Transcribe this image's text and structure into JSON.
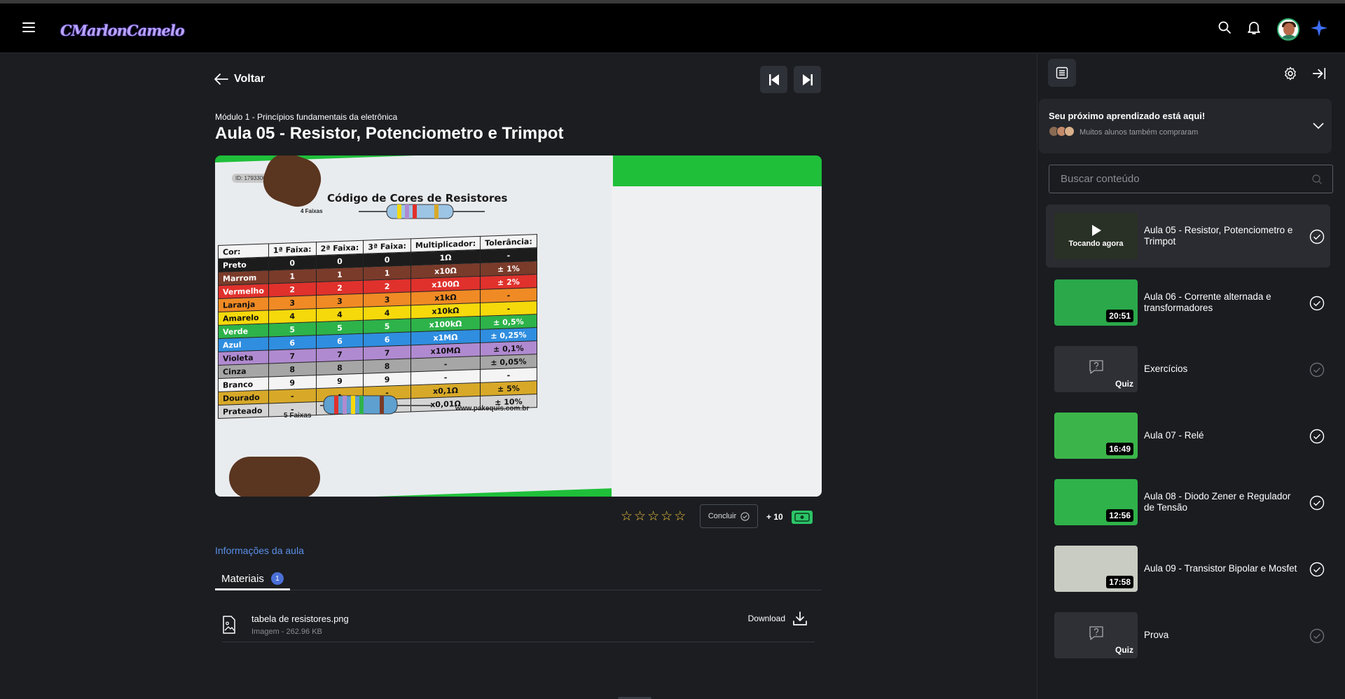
{
  "header": {
    "logo_text": "CMarlonCamelo",
    "icons": [
      "menu-icon",
      "search-icon",
      "bell-icon",
      "avatar",
      "sparkle-icon"
    ]
  },
  "lesson": {
    "back_label": "Voltar",
    "module": "Módulo 1 - Princípios fundamentais da eletrônica",
    "title": "Aula 05 - Resistor, Potenciometro e Trimpot",
    "video": {
      "id_label": "ID: 17933068",
      "chart_title": "Código de Cores de Resistores",
      "band4_label": "4 Faixas",
      "band5_label": "5 Faixas",
      "site": "www.pakequis.com.br",
      "table_headers": [
        "Cor:",
        "1ª Faixa:",
        "2ª Faixa:",
        "3ª Faixa:",
        "Multiplicador:",
        "Tolerância:"
      ],
      "table_rows": [
        {
          "cells": [
            "Preto",
            "0",
            "0",
            "0",
            "1Ω",
            "-"
          ],
          "color": "#1c1c1c",
          "text": "#ffffff"
        },
        {
          "cells": [
            "Marrom",
            "1",
            "1",
            "1",
            "x10Ω",
            "± 1%"
          ],
          "color": "#7a3b2a",
          "text": "#ffffff"
        },
        {
          "cells": [
            "Vermelho",
            "2",
            "2",
            "2",
            "x100Ω",
            "± 2%"
          ],
          "color": "#e0312c",
          "text": "#ffffff"
        },
        {
          "cells": [
            "Laranja",
            "3",
            "3",
            "3",
            "x1kΩ",
            "-"
          ],
          "color": "#f08a24",
          "text": "#111111"
        },
        {
          "cells": [
            "Amarelo",
            "4",
            "4",
            "4",
            "x10kΩ",
            "-"
          ],
          "color": "#f5d90b",
          "text": "#111111"
        },
        {
          "cells": [
            "Verde",
            "5",
            "5",
            "5",
            "x100kΩ",
            "± 0,5%"
          ],
          "color": "#2db34a",
          "text": "#ffffff"
        },
        {
          "cells": [
            "Azul",
            "6",
            "6",
            "6",
            "x1MΩ",
            "± 0,25%"
          ],
          "color": "#2f8ee0",
          "text": "#ffffff"
        },
        {
          "cells": [
            "Violeta",
            "7",
            "7",
            "7",
            "x10MΩ",
            "± 0,1%"
          ],
          "color": "#b08ad0",
          "text": "#111111"
        },
        {
          "cells": [
            "Cinza",
            "8",
            "8",
            "8",
            "-",
            "± 0,05%"
          ],
          "color": "#a6a6a6",
          "text": "#111111"
        },
        {
          "cells": [
            "Branco",
            "9",
            "9",
            "9",
            "-",
            "-"
          ],
          "color": "#f4f4f4",
          "text": "#111111"
        },
        {
          "cells": [
            "Dourado",
            "-",
            "-",
            "-",
            "x0,1Ω",
            "± 5%"
          ],
          "color": "#d8a928",
          "text": "#111111"
        },
        {
          "cells": [
            "Prateado",
            "-",
            "-",
            "-",
            "x0,01Ω",
            "± 10%"
          ],
          "color": "#d4d4d4",
          "text": "#111111"
        }
      ]
    },
    "rating": {
      "stars": 5,
      "filled": 0
    },
    "complete_label": "Concluir",
    "points": "+ 10",
    "info_link": "Informações da aula",
    "tabs": [
      {
        "label": "Materiais",
        "count": "1"
      }
    ],
    "materials": [
      {
        "name": "tabela de resistores.png",
        "meta": "Imagem - 262.96 KB",
        "action": "Download"
      }
    ]
  },
  "sidebar": {
    "promo_title": "Seu próximo aprendizado está aqui!",
    "promo_sub": "Muitos alunos também compraram",
    "search_placeholder": "Buscar conteúdo",
    "lessons": [
      {
        "title": "Aula 05 - Resistor, Potenciometro e Trimpot",
        "badge": "Tocando agora",
        "kind": "video",
        "active": true,
        "done": true
      },
      {
        "title": "Aula 06 - Corrente alternada e transformadores",
        "badge": "20:51",
        "kind": "video",
        "active": false,
        "done": true
      },
      {
        "title": "Exercícios",
        "badge": "Quiz",
        "kind": "quiz",
        "active": false,
        "done": false
      },
      {
        "title": "Aula 07 - Relé",
        "badge": "16:49",
        "kind": "video",
        "active": false,
        "done": true
      },
      {
        "title": "Aula 08 - Diodo Zener e Regulador de Tensão",
        "badge": "12:56",
        "kind": "video",
        "active": false,
        "done": true
      },
      {
        "title": "Aula 09 - Transistor Bipolar e Mosfet",
        "badge": "17:58",
        "kind": "video",
        "active": false,
        "done": true
      },
      {
        "title": "Prova",
        "badge": "Quiz",
        "kind": "quiz",
        "active": false,
        "done": false
      }
    ]
  },
  "colors": {
    "background": "#1b1d21",
    "header": "#000000",
    "accent_link": "#5b8fe6",
    "star": "#f0c43a",
    "ticket": "#2cc467",
    "badge": "#4a6fd6"
  }
}
